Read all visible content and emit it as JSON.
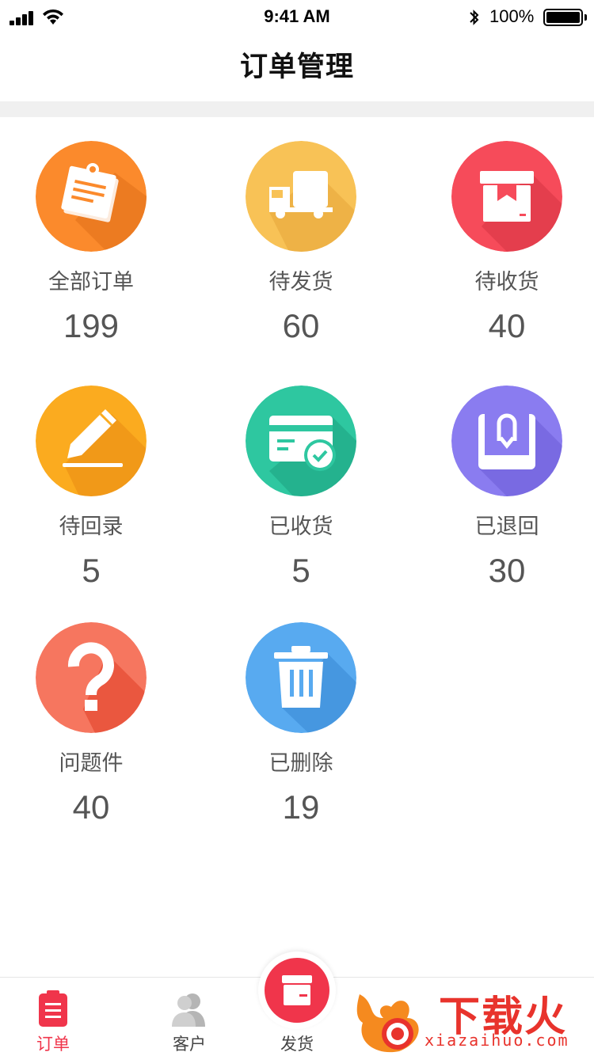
{
  "status_bar": {
    "time": "9:41 AM",
    "battery": "100%"
  },
  "header": {
    "title": "订单管理"
  },
  "tiles": [
    {
      "label": "全部订单",
      "count": "199",
      "icon": "order-note-icon",
      "color": "#fb8a2c"
    },
    {
      "label": "待发货",
      "count": "60",
      "icon": "truck-icon",
      "color": "#f8c256"
    },
    {
      "label": "待收货",
      "count": "40",
      "icon": "box-icon",
      "color": "#f64b5a"
    },
    {
      "label": "待回录",
      "count": "5",
      "icon": "pencil-icon",
      "color": "#fbab1f"
    },
    {
      "label": "已收货",
      "count": "5",
      "icon": "card-check-icon",
      "color": "#2ec7a0"
    },
    {
      "label": "已退回",
      "count": "30",
      "icon": "return-bag-icon",
      "color": "#8a7cf0"
    },
    {
      "label": "问题件",
      "count": "40",
      "icon": "question-icon",
      "color": "#f6765f"
    },
    {
      "label": "已删除",
      "count": "19",
      "icon": "trash-icon",
      "color": "#58aaf0"
    }
  ],
  "tabbar": {
    "items": [
      {
        "label": "订单",
        "icon": "clipboard-icon",
        "active": true
      },
      {
        "label": "客户",
        "icon": "customers-icon",
        "active": false
      },
      {
        "label": "发货",
        "icon": "ship-box-icon",
        "active": false
      }
    ]
  },
  "watermark": {
    "text": "下载火",
    "url": "xiazaihuo.com"
  }
}
